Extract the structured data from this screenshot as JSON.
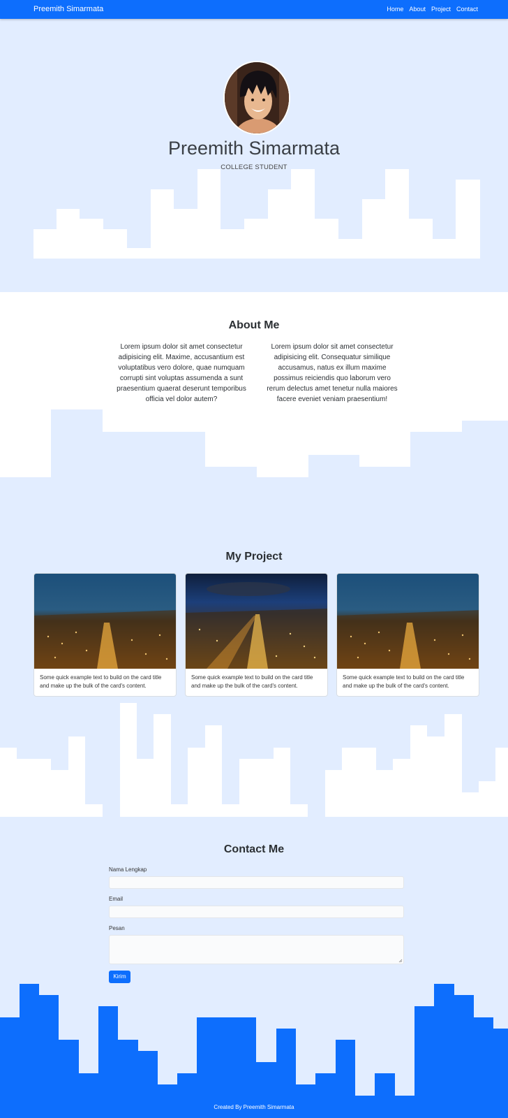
{
  "navbar": {
    "brand": "Preemith Simarmata",
    "links": [
      "Home",
      "About",
      "Project",
      "Contact"
    ]
  },
  "hero": {
    "name": "Preemith Simarmata",
    "subtitle": "COLLEGE STUDENT",
    "avatar_icon": "anime-character-avatar"
  },
  "about": {
    "title": "About Me",
    "paragraphs": [
      "Lorem ipsum dolor sit amet consectetur adipisicing elit. Maxime, accusantium est voluptatibus vero dolore, quae numquam corrupti sint voluptas assumenda a sunt praesentium quaerat deserunt temporibus officia vel dolor autem?",
      "Lorem ipsum dolor sit amet consectetur adipisicing elit. Consequatur similique accusamus, natus ex illum maxime possimus reiciendis quo laborum vero rerum delectus amet tenetur nulla maiores facere eveniet veniam praesentium!"
    ]
  },
  "project": {
    "title": "My Project",
    "cards": [
      {
        "text": "Some quick example text to build on the card title and make up the bulk of the card's content.",
        "image": "city-night-photo"
      },
      {
        "text": "Some quick example text to build on the card title and make up the bulk of the card's content.",
        "image": "city-night-photo"
      },
      {
        "text": "Some quick example text to build on the card title and make up the bulk of the card's content.",
        "image": "city-night-photo"
      }
    ]
  },
  "contact": {
    "title": "Contact Me",
    "name_label": "Nama Lengkap",
    "email_label": "Email",
    "message_label": "Pesan",
    "submit_label": "Kirim"
  },
  "footer": {
    "text": "Created By Preemith Simarmata"
  },
  "colors": {
    "primary": "#0d6efd",
    "light_bg": "#e2edff",
    "white": "#ffffff"
  }
}
